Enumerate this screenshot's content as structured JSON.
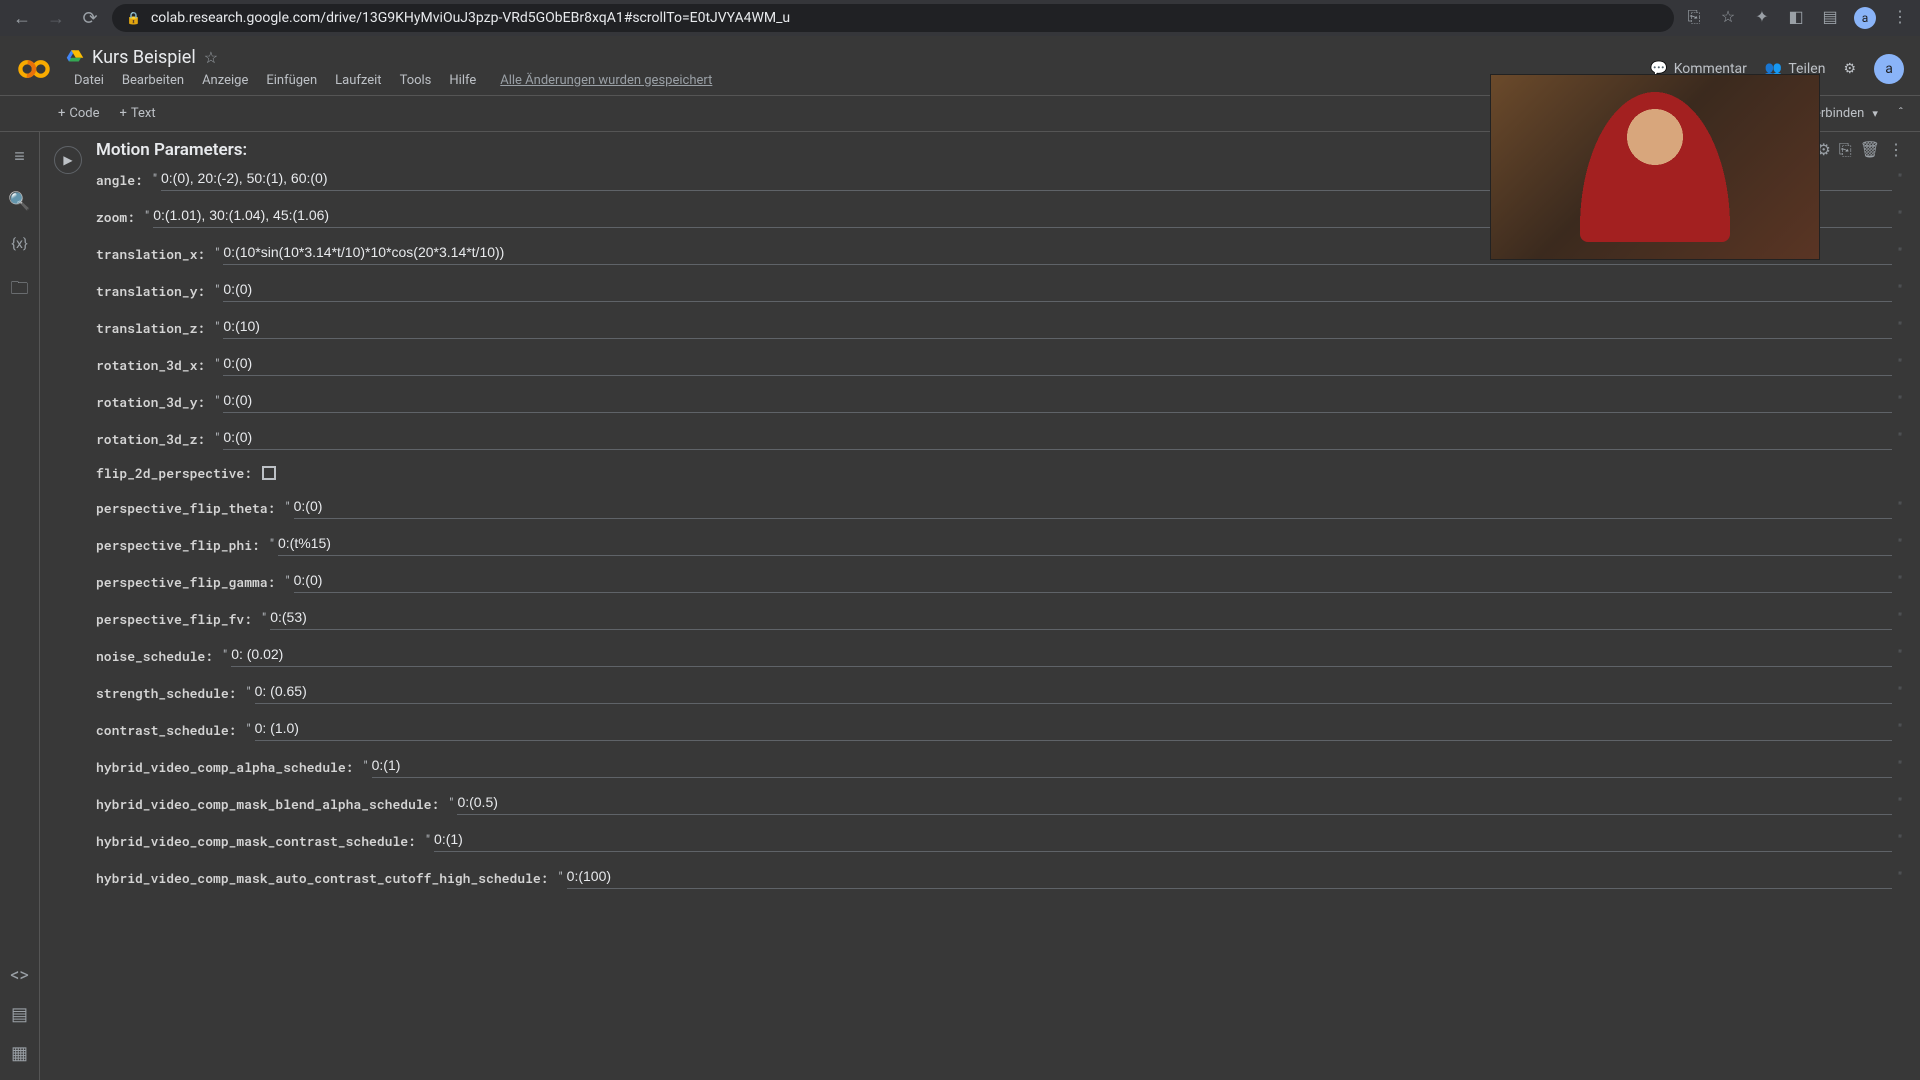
{
  "browser": {
    "url": "colab.research.google.com/drive/13G9KHyMviOuJ3pzp-VRd5GObEBr8xqA1#scrollTo=E0tJVYA4WM_u"
  },
  "header": {
    "title": "Kurs Beispiel",
    "menu": [
      "Datei",
      "Bearbeiten",
      "Anzeige",
      "Einfügen",
      "Laufzeit",
      "Tools",
      "Hilfe"
    ],
    "save_status": "Alle Änderungen wurden gespeichert",
    "kommentar": "Kommentar",
    "teilen": "Teilen",
    "avatar_letter": "a"
  },
  "toolbar": {
    "code": "Code",
    "text": "Text",
    "connect": "Verbinden"
  },
  "form": {
    "heading": "Motion Parameters:",
    "rows": [
      {
        "label": "angle:",
        "value": "0:(0), 20:(-2), 50:(1), 60:(0)"
      },
      {
        "label": "zoom:",
        "value": "0:(1.01), 30:(1.04), 45:(1.06)"
      },
      {
        "label": "translation_x:",
        "value": "0:(10*sin(10*3.14*t/10)*10*cos(20*3.14*t/10))"
      },
      {
        "label": "translation_y:",
        "value": "0:(0)"
      },
      {
        "label": "translation_z:",
        "value": "0:(10)"
      },
      {
        "label": "rotation_3d_x:",
        "value": "0:(0)"
      },
      {
        "label": "rotation_3d_y:",
        "value": "0:(0)"
      },
      {
        "label": "rotation_3d_z:",
        "value": "0:(0)"
      },
      {
        "label": "flip_2d_perspective:",
        "type": "checkbox"
      },
      {
        "label": "perspective_flip_theta:",
        "value": "0:(0)"
      },
      {
        "label": "perspective_flip_phi:",
        "value": "0:(t%15)"
      },
      {
        "label": "perspective_flip_gamma:",
        "value": "0:(0)"
      },
      {
        "label": "perspective_flip_fv:",
        "value": "0:(53)"
      },
      {
        "label": "noise_schedule:",
        "value": "0: (0.02)"
      },
      {
        "label": "strength_schedule:",
        "value": "0: (0.65)"
      },
      {
        "label": "contrast_schedule:",
        "value": "0: (1.0)"
      },
      {
        "label": "hybrid_video_comp_alpha_schedule:",
        "value": "0:(1)"
      },
      {
        "label": "hybrid_video_comp_mask_blend_alpha_schedule:",
        "value": "0:(0.5)"
      },
      {
        "label": "hybrid_video_comp_mask_contrast_schedule:",
        "value": "0:(1)"
      },
      {
        "label": "hybrid_video_comp_mask_auto_contrast_cutoff_high_schedule:",
        "value": "0:(100)"
      }
    ]
  }
}
